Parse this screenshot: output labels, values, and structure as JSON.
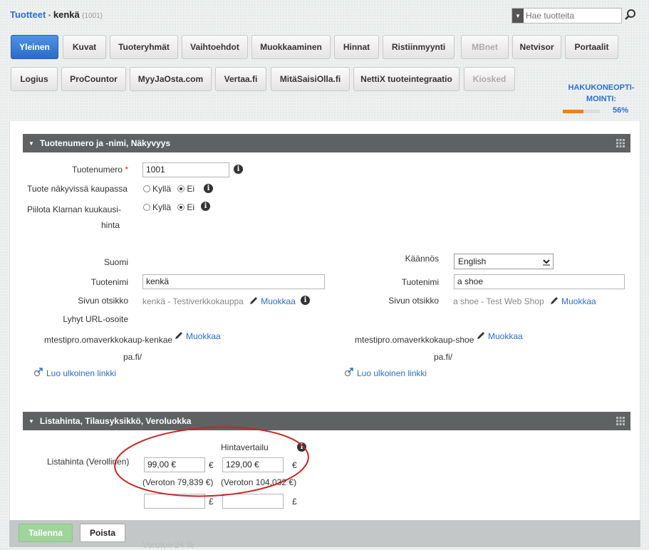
{
  "breadcrumb": {
    "root": "Tuotteet",
    "separator": "•",
    "current": "kenkä",
    "id": "(1001)"
  },
  "search": {
    "placeholder": "Hae tuotteita"
  },
  "tabs_row1": [
    {
      "label": "Yleinen",
      "state": "active"
    },
    {
      "label": "Kuvat"
    },
    {
      "label": "Tuoteryhmät"
    },
    {
      "label": "Vaihtoehdot"
    },
    {
      "label": "Muokkaaminen"
    },
    {
      "label": "Hinnat"
    },
    {
      "label": "Ristiinmyynti"
    },
    {
      "label": "MBnet",
      "state": "disabled"
    },
    {
      "label": "Netvisor"
    },
    {
      "label": "Portaalit"
    }
  ],
  "tabs_row2": [
    {
      "label": "Logius"
    },
    {
      "label": "ProCountor"
    },
    {
      "label": "MyyJaOsta.com"
    },
    {
      "label": "Vertaa.fi"
    },
    {
      "label": "MitäSaisiOlla.fi"
    },
    {
      "label": "NettiX tuoteintegraatio"
    },
    {
      "label": "Kiosked",
      "state": "disabled"
    }
  ],
  "seo": {
    "title_line1": "HAKUKONEOPTI-",
    "title_line2": "MOINTI:",
    "percent_label": "56%",
    "percent": 56
  },
  "section1": {
    "title": "Tuotenumero ja -nimi, Näkyvyys",
    "product_number_label": "Tuotenumero",
    "required_mark": "*",
    "product_number_value": "1001",
    "visible_label": "Tuote näkyvissä kaupassa",
    "hide_klarna_label_line1": "Piilota Klarnan kuukausi-",
    "hide_klarna_label_line2": "hinta",
    "yes": "Kyllä",
    "no": "Ei",
    "lang_fi": "Suomi",
    "translation_label": "Käännös",
    "translation_value": "English",
    "name_label": "Tuotenimi",
    "name_fi": "kenkä",
    "name_en": "a shoe",
    "page_title_label": "Sivun otsikko",
    "page_title_fi": "kenkä - Testiverkkokauppa",
    "page_title_en": "a shoe - Test Web Shop",
    "edit": "Muokkaa",
    "short_url_label": "Lyhyt URL-osoite",
    "url_fi_line1": "mtestipro.omaverkkokaup-kenkae",
    "url_fi_line2": "pa.fi/",
    "url_en_line1": "mtestipro.omaverkkokaup-shoe",
    "url_en_line2": "pa.fi/",
    "external_link": "Luo ulkoinen linkki"
  },
  "section2": {
    "title": "Listahinta, Tilausyksikkö, Veroluokka",
    "price_compare_label": "Hintavertailu",
    "list_price_label": "Listahinta (Verollinen)",
    "price_eur": "99,00 €",
    "compare_eur": "129,00 €",
    "euro": "€",
    "pound": "£",
    "net_price": "(Veroton 79,839 €)",
    "net_compare": "(Veroton 104,032 €)",
    "hidden_value": "Veroton 24 %"
  },
  "actions": {
    "save": "Tallenna",
    "delete": "Poista"
  },
  "colors": {
    "accent": "#2a6fd0",
    "header_bar": "#5f6263",
    "highlight": "#cc2222",
    "progress": "#f0801a"
  }
}
